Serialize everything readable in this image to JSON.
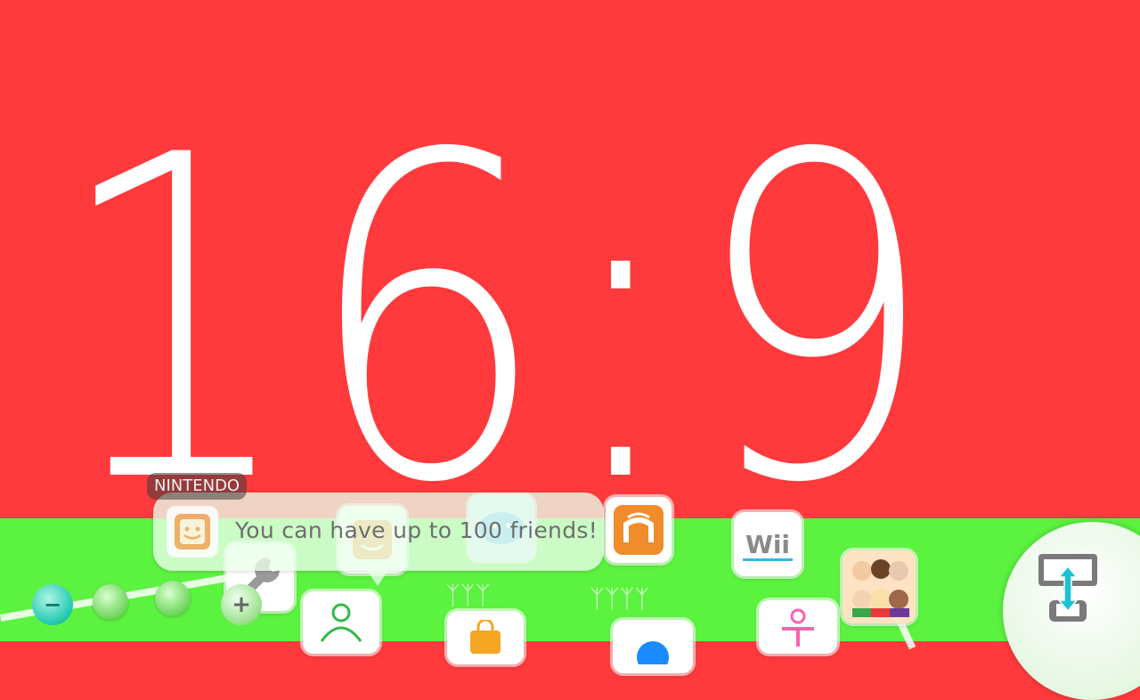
{
  "background": {
    "top_color": "#ff3a3d",
    "bottom_color": "#5cf240",
    "aspect_label": "16:9"
  },
  "notification": {
    "tag": "NINTENDO",
    "message": "You can have up to 100 friends!",
    "icon": "friend-list-icon"
  },
  "page_dots": [
    "page-dot",
    "page-dot"
  ],
  "zoom": {
    "minus_label": "−",
    "plus_label": "+"
  },
  "tiles": [
    {
      "name": "system-settings-icon",
      "color": "#9a9a9a"
    },
    {
      "name": "friend-list-icon",
      "color": "#f39c3b"
    },
    {
      "name": "miiverse-icon",
      "color": "#3fa6ff"
    },
    {
      "name": "nintendo-network-icon",
      "color": "#f08c2a"
    },
    {
      "name": "wii-menu-icon",
      "color": "#3ab4e6"
    },
    {
      "name": "mii-maker-icon",
      "color": "#ff8f3d"
    },
    {
      "name": "nintendo-eshop-icon",
      "color": "#f5a623"
    },
    {
      "name": "internet-browser-icon",
      "color": "#1a8cff"
    },
    {
      "name": "tvii-icon",
      "color": "#ff5fb0"
    },
    {
      "name": "parental-controls-icon",
      "color": "#34b84a"
    }
  ],
  "drc_switch": {
    "icon": "gamepad-screen-switch-icon"
  }
}
